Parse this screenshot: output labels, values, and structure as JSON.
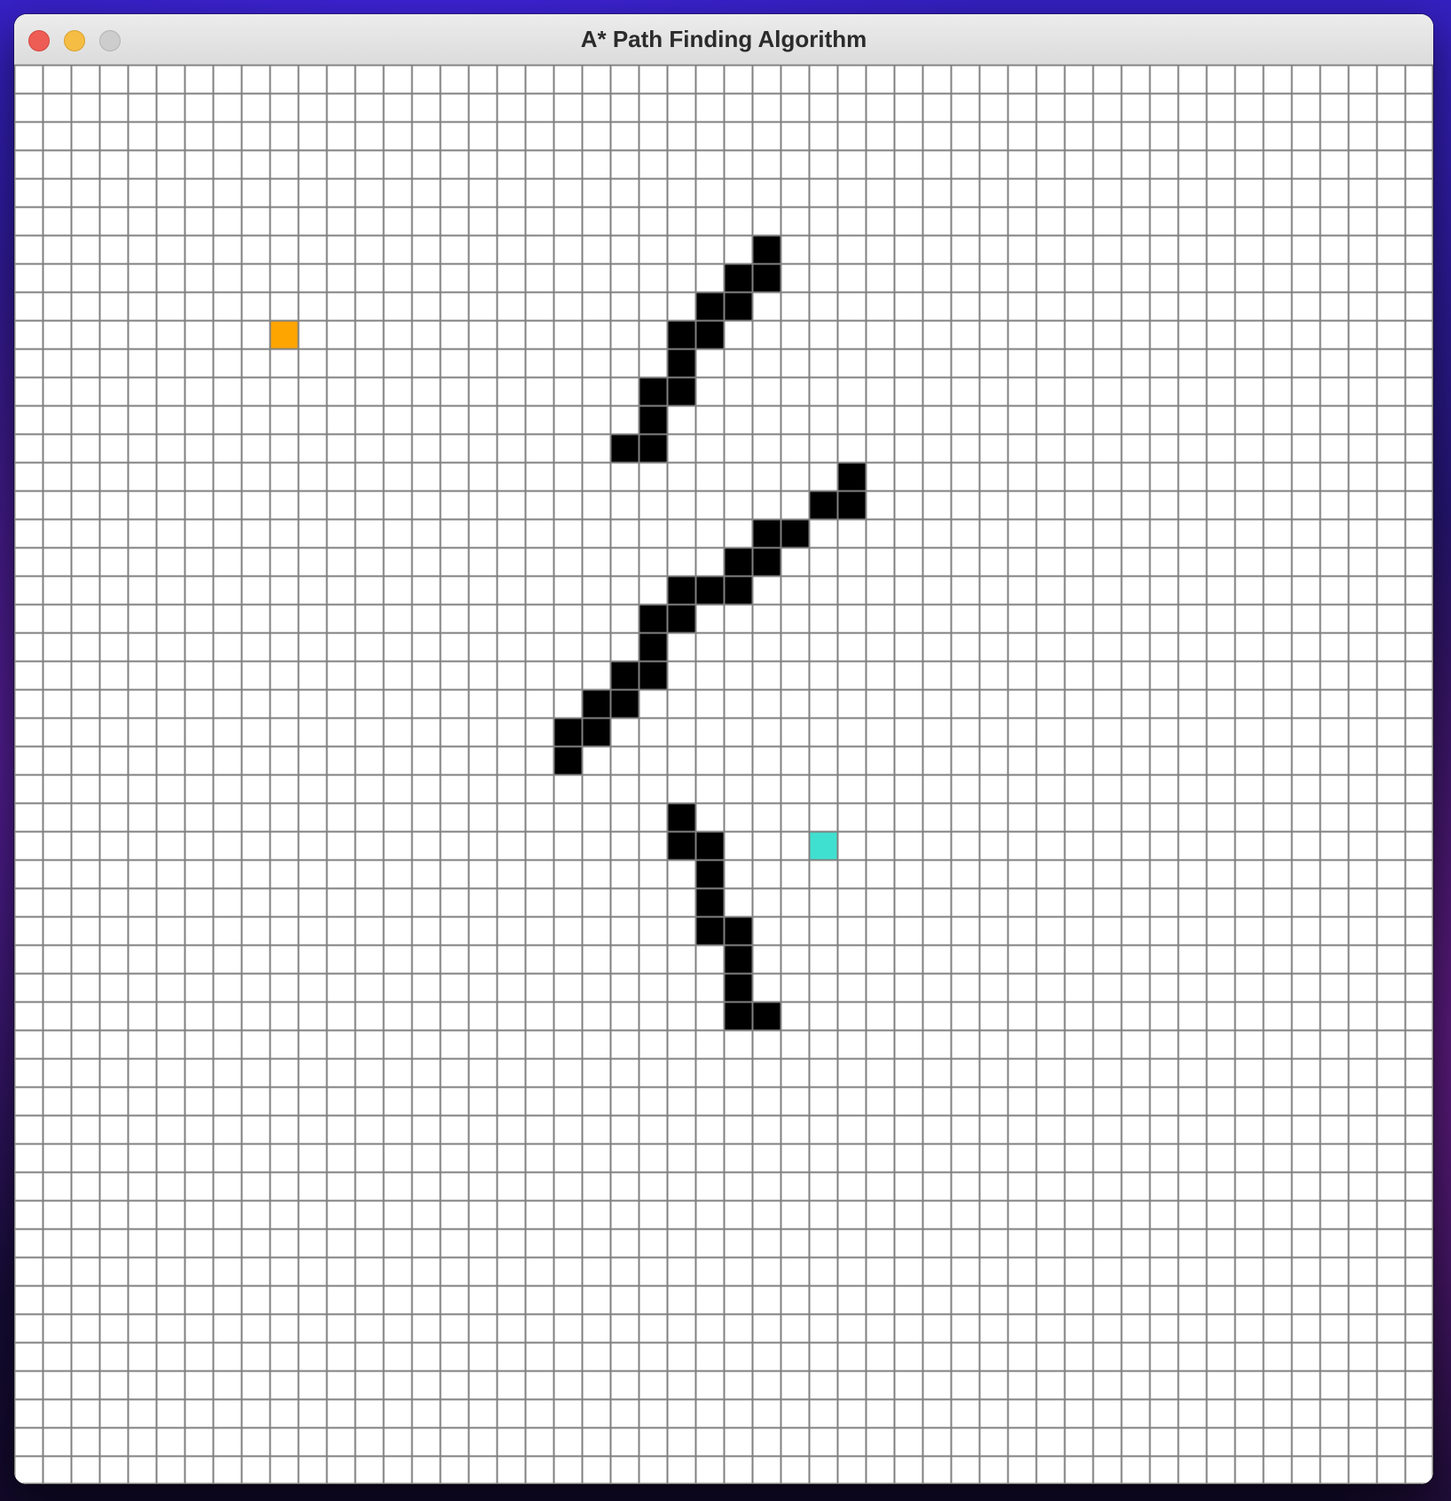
{
  "window": {
    "title": "A* Path Finding Algorithm",
    "controls": {
      "close": "close-icon",
      "minimize": "minimize-icon",
      "zoom": "zoom-icon"
    }
  },
  "grid": {
    "rows": 50,
    "cols": 50,
    "colors": {
      "empty": "#ffffff",
      "line": "#808080",
      "barrier": "#000000",
      "start": "#ffa500",
      "end": "#40e0d0"
    },
    "start": {
      "row": 9,
      "col": 9
    },
    "end": {
      "row": 27,
      "col": 28
    },
    "barriers": [
      [
        6,
        26
      ],
      [
        7,
        25
      ],
      [
        7,
        26
      ],
      [
        8,
        24
      ],
      [
        8,
        25
      ],
      [
        9,
        23
      ],
      [
        9,
        24
      ],
      [
        10,
        23
      ],
      [
        11,
        22
      ],
      [
        11,
        23
      ],
      [
        12,
        22
      ],
      [
        13,
        21
      ],
      [
        13,
        22
      ],
      [
        14,
        29
      ],
      [
        15,
        28
      ],
      [
        15,
        29
      ],
      [
        16,
        26
      ],
      [
        16,
        27
      ],
      [
        17,
        25
      ],
      [
        17,
        26
      ],
      [
        18,
        23
      ],
      [
        18,
        24
      ],
      [
        18,
        25
      ],
      [
        19,
        22
      ],
      [
        19,
        23
      ],
      [
        20,
        22
      ],
      [
        21,
        21
      ],
      [
        21,
        22
      ],
      [
        22,
        20
      ],
      [
        22,
        21
      ],
      [
        23,
        19
      ],
      [
        23,
        20
      ],
      [
        24,
        19
      ],
      [
        26,
        23
      ],
      [
        27,
        23
      ],
      [
        27,
        24
      ],
      [
        28,
        24
      ],
      [
        29,
        24
      ],
      [
        30,
        24
      ],
      [
        30,
        25
      ],
      [
        31,
        25
      ],
      [
        32,
        25
      ],
      [
        33,
        25
      ],
      [
        33,
        26
      ]
    ]
  }
}
